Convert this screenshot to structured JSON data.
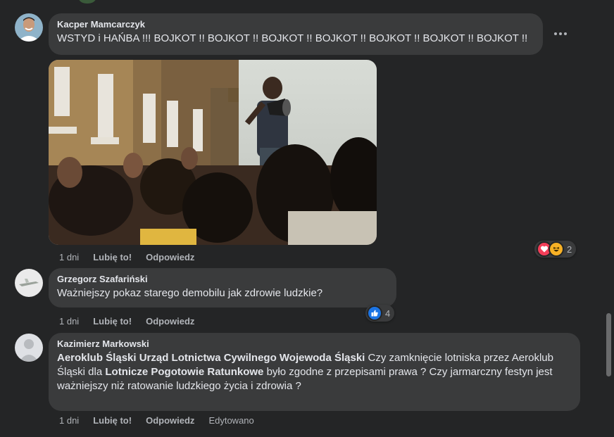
{
  "comments": [
    {
      "author": "Kacper Mamcarczyk",
      "text": "WSTYD i HAŃBA !!! BOJKOT !! BOJKOT !! BOJKOT !! BOJKOT !! BOJKOT !! BOJKOT !! BOJKOT !!",
      "time": "1 dni",
      "like_label": "Lubię to!",
      "reply_label": "Odpowiedz",
      "reactions_count": "2",
      "reaction_icons": [
        "love-icon",
        "haha-icon"
      ]
    },
    {
      "author": "Grzegorz Szafariński",
      "text": "Ważniejszy pokaz starego demobilu jak zdrowie ludzkie?",
      "time": "1 dni",
      "like_label": "Lubię to!",
      "reply_label": "Odpowiedz",
      "reactions_count": "4",
      "reaction_icons": [
        "like-icon"
      ]
    },
    {
      "author": "Kazimierz Markowski",
      "tag1": "Aeroklub Śląski",
      "tag2": "Urząd Lotnictwa Cywilnego",
      "tag3": "Wojewoda Śląski",
      "text_part1": "Czy zamknięcie lotniska przez Aeroklub Śląski dla",
      "tag4": "Lotnicze Pogotowie Ratunkowe",
      "text_part2": "było zgodne z przepisami prawa ? Czy jarmarczny festyn jest ważniejszy niż ratowanie ludzkiego życia i zdrowia ?",
      "time": "1 dni",
      "like_label": "Lubię to!",
      "reply_label": "Odpowiedz",
      "edited_label": "Edytowano"
    }
  ],
  "colors": {
    "background": "#242526",
    "bubble": "#3a3b3c",
    "text": "#e4e6eb",
    "secondary_text": "#b0b3b8",
    "love": "#f33e58",
    "haha": "#f7b125",
    "like": "#1b74e4"
  }
}
